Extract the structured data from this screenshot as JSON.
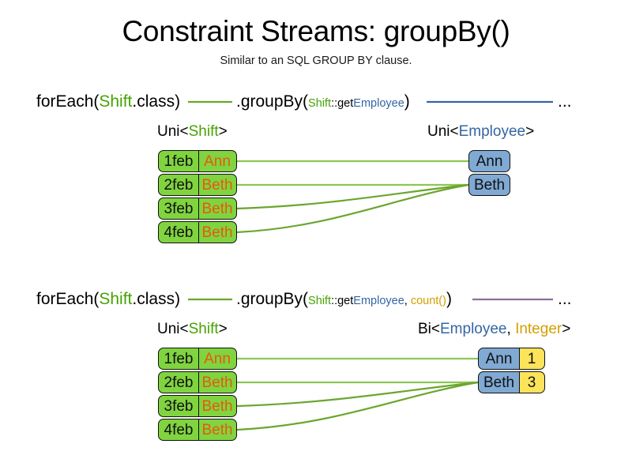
{
  "header": {
    "title": "Constraint Streams: groupBy()",
    "subtitle": "Similar to an SQL GROUP BY clause."
  },
  "colors": {
    "shift_green": "#46a302",
    "employee_blue": "#3465a4",
    "count_gold": "#d3a000",
    "box_green": "#80d43f",
    "box_blue": "#80a9d4",
    "box_yellow": "#fbe35a",
    "name_orange": "#e8590c",
    "link_green": "#6aa62e",
    "link_blue": "#3465a4",
    "link_purple": "#8b6f9e",
    "text_black": "#000000"
  },
  "examples": [
    {
      "id": "groupby-single",
      "signature": {
        "for_each": "forEach(",
        "for_each_type": "Shift",
        "for_each_suffix": ".class)",
        "group_by": ".groupBy(",
        "param_owner": "Shift",
        "param_sep": "::get",
        "param_prop": "Employee",
        "group_by_close": ")",
        "ellipsis": "..."
      },
      "source_label": {
        "prefix": "Uni<",
        "type": "Shift",
        "suffix": ">"
      },
      "result_label": {
        "prefix": "Uni<",
        "type": "Employee",
        "suffix": ">"
      },
      "source_rows": [
        {
          "date": "1feb",
          "name": "Ann"
        },
        {
          "date": "2feb",
          "name": "Beth"
        },
        {
          "date": "3feb",
          "name": "Beth"
        },
        {
          "date": "4feb",
          "name": "Beth"
        }
      ],
      "result_rows": [
        {
          "employee": "Ann"
        },
        {
          "employee": "Beth"
        }
      ],
      "mapping": [
        0,
        1,
        1,
        1
      ]
    },
    {
      "id": "groupby-count",
      "signature": {
        "for_each": "forEach(",
        "for_each_type": "Shift",
        "for_each_suffix": ".class)",
        "group_by": ".groupBy(",
        "param_owner": "Shift",
        "param_sep": "::get",
        "param_prop": "Employee",
        "param_comma": ", ",
        "param_collector": "count()",
        "group_by_close": ")",
        "ellipsis": "..."
      },
      "source_label": {
        "prefix": "Uni<",
        "type": "Shift",
        "suffix": ">"
      },
      "result_label": {
        "prefix": "Bi<",
        "type": "Employee",
        "separator": ", ",
        "type2": "Integer",
        "suffix": ">"
      },
      "source_rows": [
        {
          "date": "1feb",
          "name": "Ann"
        },
        {
          "date": "2feb",
          "name": "Beth"
        },
        {
          "date": "3feb",
          "name": "Beth"
        },
        {
          "date": "4feb",
          "name": "Beth"
        }
      ],
      "result_rows": [
        {
          "employee": "Ann",
          "count": "1"
        },
        {
          "employee": "Beth",
          "count": "3"
        }
      ],
      "mapping": [
        0,
        1,
        1,
        1
      ]
    }
  ]
}
